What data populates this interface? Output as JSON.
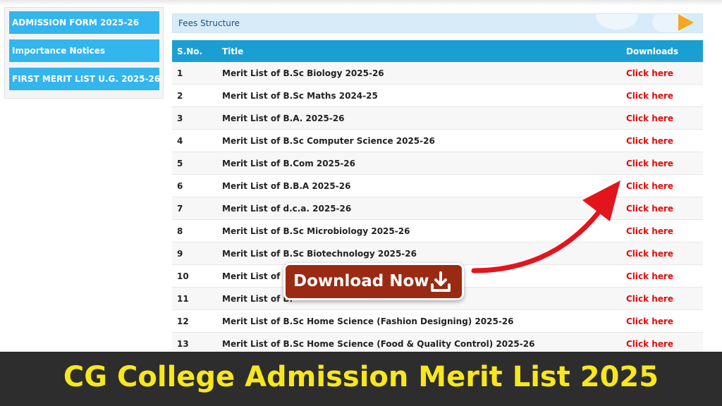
{
  "sidebar": {
    "items": [
      {
        "label": "ADMISSION FORM 2025-26"
      },
      {
        "label": "Importance Notices"
      },
      {
        "label": "FIRST MERIT LIST U.G. 2025-26"
      }
    ]
  },
  "fees": {
    "label": "Fees Structure"
  },
  "table": {
    "headers": [
      "S.No.",
      "Title",
      "Downloads"
    ],
    "rows": [
      {
        "sno": "1",
        "title": "Merit List of B.Sc Biology 2025-26",
        "link": "Click here"
      },
      {
        "sno": "2",
        "title": "Merit List of B.Sc Maths 2024-25",
        "link": "Click here"
      },
      {
        "sno": "3",
        "title": "Merit List of B.A. 2025-26",
        "link": "Click here"
      },
      {
        "sno": "4",
        "title": "Merit List of B.Sc Computer Science 2025-26",
        "link": "Click here"
      },
      {
        "sno": "5",
        "title": "Merit List of B.Com 2025-26",
        "link": "Click here"
      },
      {
        "sno": "6",
        "title": "Merit List of B.B.A 2025-26",
        "link": "Click here"
      },
      {
        "sno": "7",
        "title": "Merit List of d.c.a. 2025-26",
        "link": "Click here"
      },
      {
        "sno": "8",
        "title": "Merit List of B.Sc Microbiology 2025-26",
        "link": "Click here"
      },
      {
        "sno": "9",
        "title": "Merit List of B.Sc Biotechnology 2025-26",
        "link": "Click here"
      },
      {
        "sno": "10",
        "title": "Merit List of B",
        "link": "Click here"
      },
      {
        "sno": "11",
        "title": "Merit List of B.",
        "link": "Click here"
      },
      {
        "sno": "12",
        "title": "Merit List of B.Sc Home Science (Fashion Designing) 2025-26",
        "link": "Click here"
      },
      {
        "sno": "13",
        "title": "Merit List of B.Sc Home Science (Food & Quality Control) 2025-26",
        "link": "Click here"
      }
    ]
  },
  "download_button": {
    "label": "Download Now",
    "icon": "download-icon"
  },
  "banner": {
    "title": "CG College Admission Merit List 2025"
  },
  "colors": {
    "sidebar_item": "#33b5ed",
    "table_header": "#1b9fd3",
    "link": "#e10c0c",
    "button": "#9a2a12",
    "arrow": "#e3141b",
    "banner_bg": "#2d2d2d",
    "banner_text": "#f8e71c"
  }
}
